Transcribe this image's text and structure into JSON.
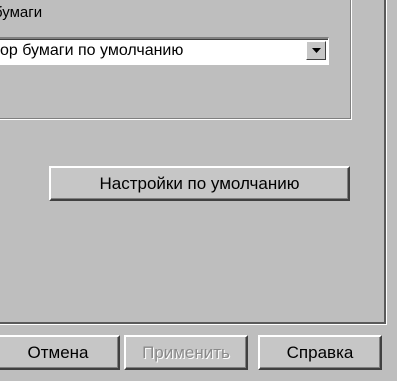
{
  "paper_group": {
    "label": "бумаги",
    "source_select": {
      "value": "ор бумаги по умолчанию"
    }
  },
  "buttons": {
    "defaults_label": "Настройки по умолчанию",
    "cancel_label": "Отмена",
    "apply_label": "Применить",
    "help_label": "Справка"
  },
  "icons": {
    "dropdown": "chevron-down-icon"
  },
  "colors": {
    "face": "#c6c6c6",
    "background": "#bebebe",
    "disabled_text": "#8a8a8a"
  }
}
